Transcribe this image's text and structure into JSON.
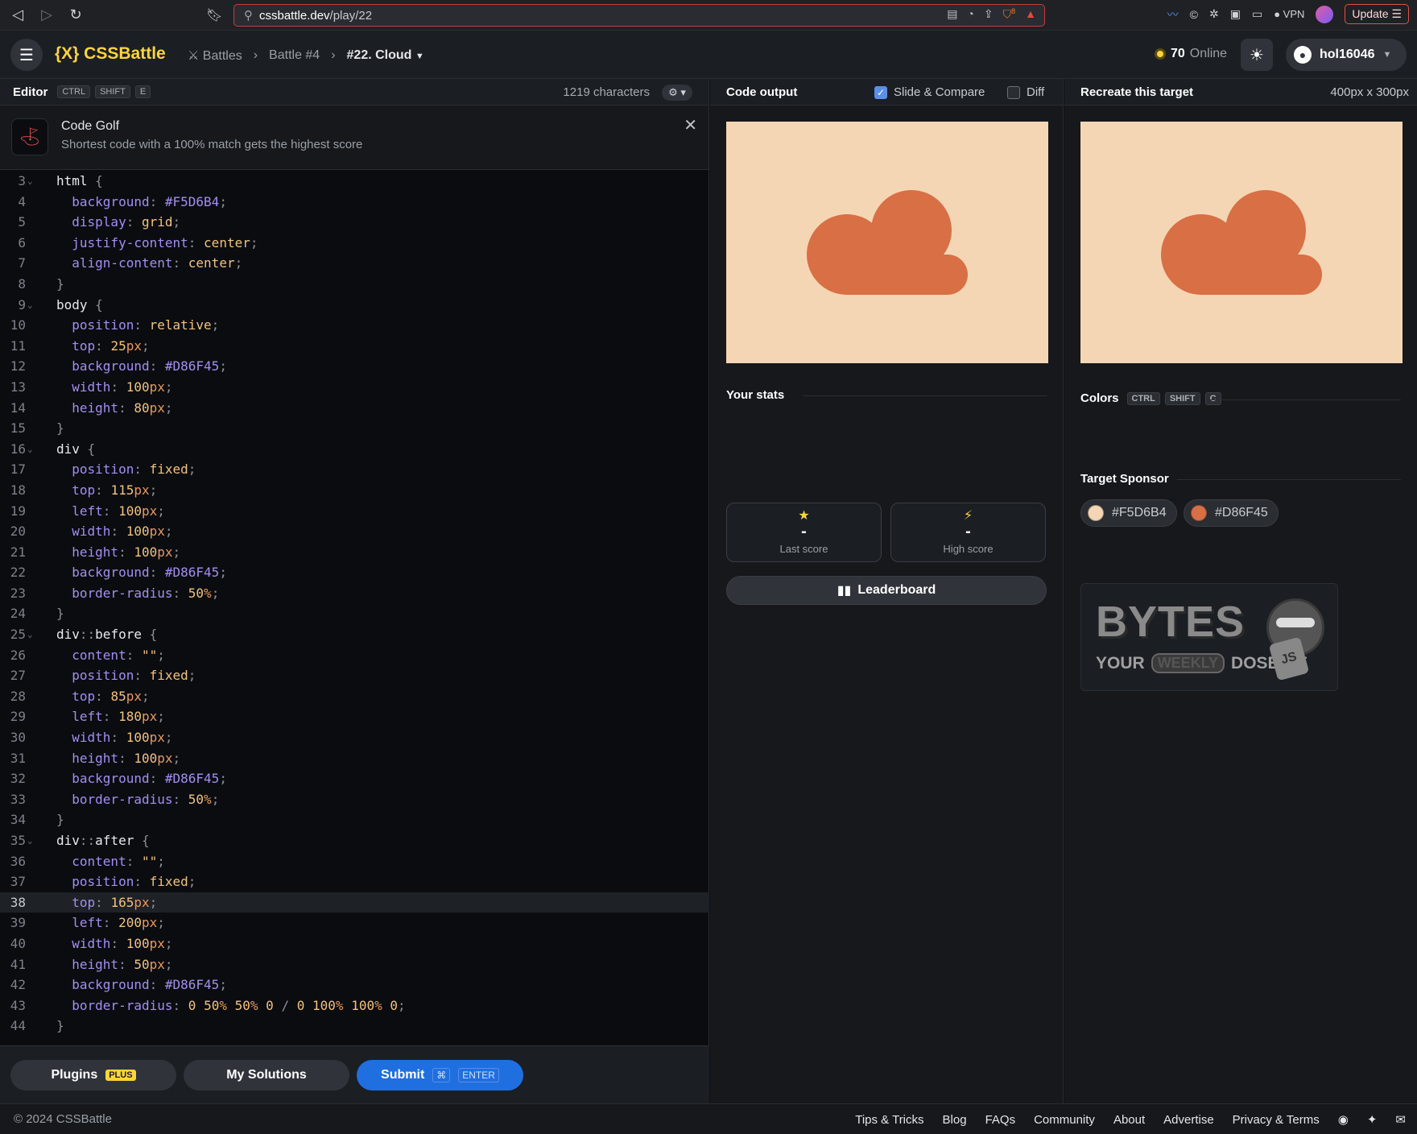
{
  "browser": {
    "url_host": "cssbattle.dev",
    "url_path": "/play/22",
    "brave_badge": "8",
    "vpn_label": "VPN",
    "update_label": "Update"
  },
  "header": {
    "logo": "{X} CSSBattle",
    "breadcrumbs": [
      "Battles",
      "Battle #4",
      "#22. Cloud"
    ],
    "online_count": "70",
    "online_label": "Online",
    "username": "hol16046"
  },
  "editor": {
    "title": "Editor",
    "shortcut": [
      "CTRL",
      "SHIFT",
      "E"
    ],
    "char_count": "1219 characters",
    "banner_title": "Code Golf",
    "banner_text": "Shortest code with a 100% match gets the highest score",
    "active_line": 38,
    "lines": [
      {
        "n": "3",
        "fold": true,
        "html": "<span class='sel'>html</span> <span class='punc'>{</span>"
      },
      {
        "n": "4",
        "html": "  <span class='prop'>background</span><span class='punc'>:</span> <span class='prop'>#F5D6B4</span><span class='punc'>;</span>"
      },
      {
        "n": "5",
        "html": "  <span class='prop'>display</span><span class='punc'>:</span> <span class='val'>grid</span><span class='punc'>;</span>"
      },
      {
        "n": "6",
        "html": "  <span class='prop'>justify-content</span><span class='punc'>:</span> <span class='val'>center</span><span class='punc'>;</span>"
      },
      {
        "n": "7",
        "html": "  <span class='prop'>align-content</span><span class='punc'>:</span> <span class='val'>center</span><span class='punc'>;</span>"
      },
      {
        "n": "8",
        "html": "<span class='punc'>}</span>"
      },
      {
        "n": "9",
        "fold": true,
        "html": "<span class='sel'>body</span> <span class='punc'>{</span>"
      },
      {
        "n": "10",
        "html": "  <span class='prop'>position</span><span class='punc'>:</span> <span class='val'>relative</span><span class='punc'>;</span>"
      },
      {
        "n": "11",
        "html": "  <span class='prop'>top</span><span class='punc'>:</span> <span class='val'>25</span><span class='unit'>px</span><span class='punc'>;</span>"
      },
      {
        "n": "12",
        "html": "  <span class='prop'>background</span><span class='punc'>:</span> <span class='prop'>#D86F45</span><span class='punc'>;</span>"
      },
      {
        "n": "13",
        "html": "  <span class='prop'>width</span><span class='punc'>:</span> <span class='val'>100</span><span class='unit'>px</span><span class='punc'>;</span>"
      },
      {
        "n": "14",
        "html": "  <span class='prop'>height</span><span class='punc'>:</span> <span class='val'>80</span><span class='unit'>px</span><span class='punc'>;</span>"
      },
      {
        "n": "15",
        "html": "<span class='punc'>}</span>"
      },
      {
        "n": "16",
        "fold": true,
        "html": "<span class='sel'>div</span> <span class='punc'>{</span>"
      },
      {
        "n": "17",
        "html": "  <span class='prop'>position</span><span class='punc'>:</span> <span class='val'>fixed</span><span class='punc'>;</span>"
      },
      {
        "n": "18",
        "html": "  <span class='prop'>top</span><span class='punc'>:</span> <span class='val'>115</span><span class='unit'>px</span><span class='punc'>;</span>"
      },
      {
        "n": "19",
        "html": "  <span class='prop'>left</span><span class='punc'>:</span> <span class='val'>100</span><span class='unit'>px</span><span class='punc'>;</span>"
      },
      {
        "n": "20",
        "html": "  <span class='prop'>width</span><span class='punc'>:</span> <span class='val'>100</span><span class='unit'>px</span><span class='punc'>;</span>"
      },
      {
        "n": "21",
        "html": "  <span class='prop'>height</span><span class='punc'>:</span> <span class='val'>100</span><span class='unit'>px</span><span class='punc'>;</span>"
      },
      {
        "n": "22",
        "html": "  <span class='prop'>background</span><span class='punc'>:</span> <span class='prop'>#D86F45</span><span class='punc'>;</span>"
      },
      {
        "n": "23",
        "html": "  <span class='prop'>border-radius</span><span class='punc'>:</span> <span class='val'>50</span><span class='unit'>%</span><span class='punc'>;</span>"
      },
      {
        "n": "24",
        "html": "<span class='punc'>}</span>"
      },
      {
        "n": "25",
        "fold": true,
        "html": "<span class='sel'>div</span><span class='punc'>::</span><span class='sel'>before</span> <span class='punc'>{</span>"
      },
      {
        "n": "26",
        "html": "  <span class='prop'>content</span><span class='punc'>:</span> <span class='val'>\"\"</span><span class='punc'>;</span>"
      },
      {
        "n": "27",
        "html": "  <span class='prop'>position</span><span class='punc'>:</span> <span class='val'>fixed</span><span class='punc'>;</span>"
      },
      {
        "n": "28",
        "html": "  <span class='prop'>top</span><span class='punc'>:</span> <span class='val'>85</span><span class='unit'>px</span><span class='punc'>;</span>"
      },
      {
        "n": "29",
        "html": "  <span class='prop'>left</span><span class='punc'>:</span> <span class='val'>180</span><span class='unit'>px</span><span class='punc'>;</span>"
      },
      {
        "n": "30",
        "html": "  <span class='prop'>width</span><span class='punc'>:</span> <span class='val'>100</span><span class='unit'>px</span><span class='punc'>;</span>"
      },
      {
        "n": "31",
        "html": "  <span class='prop'>height</span><span class='punc'>:</span> <span class='val'>100</span><span class='unit'>px</span><span class='punc'>;</span>"
      },
      {
        "n": "32",
        "html": "  <span class='prop'>background</span><span class='punc'>:</span> <span class='prop'>#D86F45</span><span class='punc'>;</span>"
      },
      {
        "n": "33",
        "html": "  <span class='prop'>border-radius</span><span class='punc'>:</span> <span class='val'>50</span><span class='unit'>%</span><span class='punc'>;</span>"
      },
      {
        "n": "34",
        "html": "<span class='punc'>}</span>"
      },
      {
        "n": "35",
        "fold": true,
        "html": "<span class='sel'>div</span><span class='punc'>::</span><span class='sel'>after</span> <span class='punc'>{</span>"
      },
      {
        "n": "36",
        "html": "  <span class='prop'>content</span><span class='punc'>:</span> <span class='val'>\"\"</span><span class='punc'>;</span>"
      },
      {
        "n": "37",
        "html": "  <span class='prop'>position</span><span class='punc'>:</span> <span class='val'>fixed</span><span class='punc'>;</span>"
      },
      {
        "n": "38",
        "html": "  <span class='prop'>top</span><span class='punc'>:</span> <span class='val'>165</span><span class='unit'>px</span><span class='punc'>;</span>"
      },
      {
        "n": "39",
        "html": "  <span class='prop'>left</span><span class='punc'>:</span> <span class='val'>200</span><span class='unit'>px</span><span class='punc'>;</span>"
      },
      {
        "n": "40",
        "html": "  <span class='prop'>width</span><span class='punc'>:</span> <span class='val'>100</span><span class='unit'>px</span><span class='punc'>;</span>"
      },
      {
        "n": "41",
        "html": "  <span class='prop'>height</span><span class='punc'>:</span> <span class='val'>50</span><span class='unit'>px</span><span class='punc'>;</span>"
      },
      {
        "n": "42",
        "html": "  <span class='prop'>background</span><span class='punc'>:</span> <span class='prop'>#D86F45</span><span class='punc'>;</span>"
      },
      {
        "n": "43",
        "html": "  <span class='prop'>border-radius</span><span class='punc'>:</span> <span class='val'>0</span> <span class='val'>50</span><span class='unit'>%</span> <span class='val'>50</span><span class='unit'>%</span> <span class='val'>0</span> <span class='punc'>/</span> <span class='val'>0</span> <span class='val'>100</span><span class='unit'>%</span> <span class='val'>100</span><span class='unit'>%</span> <span class='val'>0</span><span class='punc'>;</span>"
      },
      {
        "n": "44",
        "html": "<span class='punc'>}</span>"
      }
    ],
    "footer": {
      "plugins_label": "Plugins",
      "plus_badge": "PLUS",
      "solutions_label": "My Solutions",
      "submit_label": "Submit",
      "submit_shortcut": "⌘",
      "submit_key": "ENTER"
    }
  },
  "output": {
    "title": "Code output",
    "slide_compare_label": "Slide & Compare",
    "slide_compare_checked": true,
    "diff_label": "Diff",
    "diff_checked": false,
    "stats_title": "Your stats",
    "last_score_value": "-",
    "last_score_label": "Last score",
    "high_score_value": "-",
    "high_score_label": "High score",
    "leaderboard_label": "Leaderboard"
  },
  "target": {
    "title": "Recreate this target",
    "dims": "400px x 300px",
    "colors_title": "Colors",
    "colors_shortcut": [
      "CTRL",
      "SHIFT",
      "C"
    ],
    "colors": [
      {
        "hex": "#F5D6B4"
      },
      {
        "hex": "#D86F45"
      }
    ],
    "sponsor_title": "Target Sponsor",
    "sponsor_big": "BYTES",
    "sponsor_your": "YOUR",
    "sponsor_weekly": "WEEKLY",
    "sponsor_dose": "DOSE OF",
    "sponsor_js": "JS"
  },
  "footer": {
    "copyright": "© 2024 CSSBattle",
    "links": [
      "Tips & Tricks",
      "Blog",
      "FAQs",
      "Community",
      "About",
      "Advertise",
      "Privacy & Terms"
    ]
  }
}
